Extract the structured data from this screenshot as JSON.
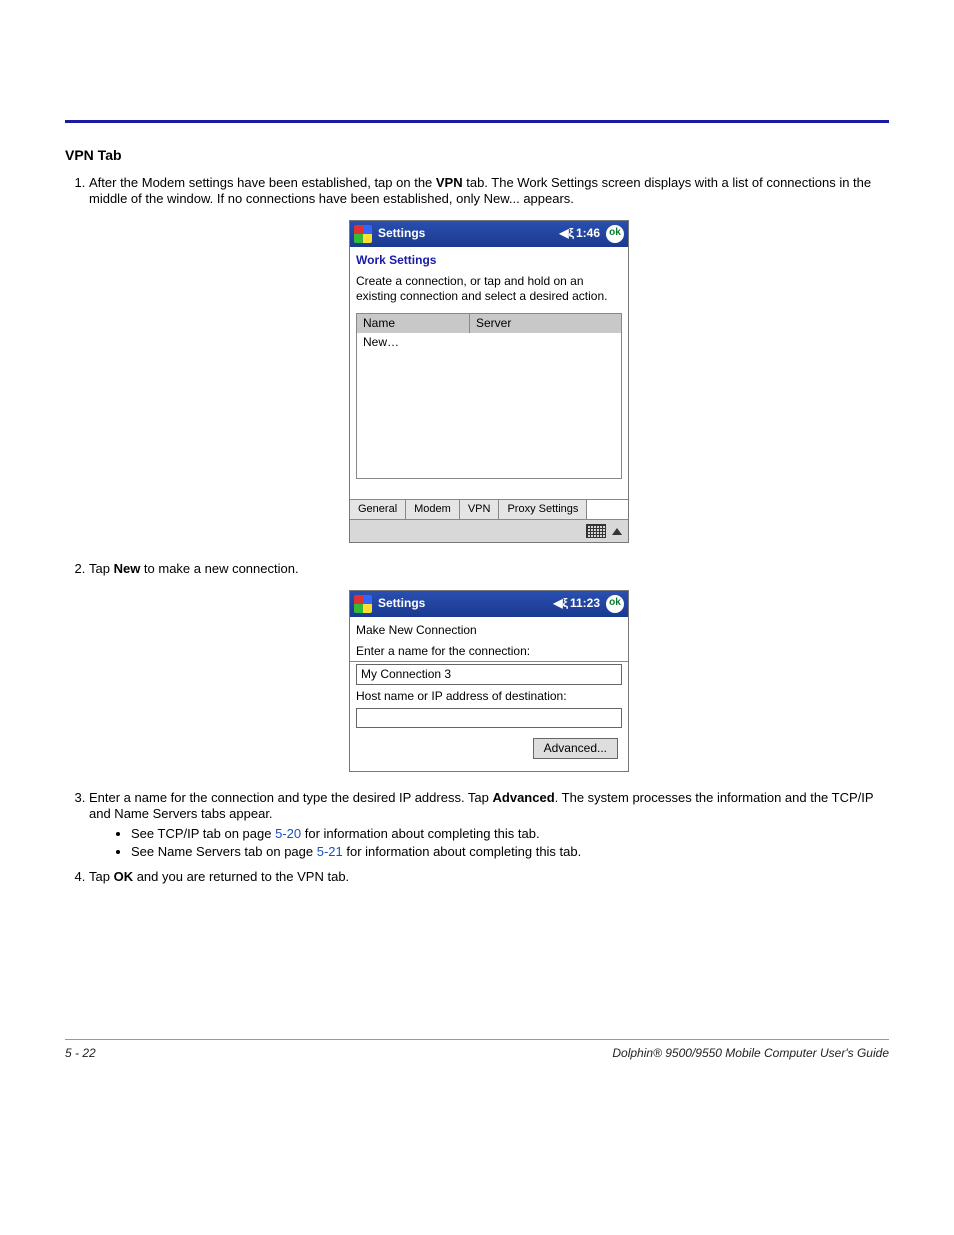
{
  "heading": "VPN Tab",
  "steps": {
    "s1a": "After the Modem settings have been established, tap on the ",
    "s1b": "VPN",
    "s1c": " tab. The Work Settings screen displays with a list of connections in the middle of the window. If no connections have been established, only New... appears.",
    "s2a": "Tap ",
    "s2b": "New",
    "s2c": " to make a new connection.",
    "s3a": "Enter a name for the connection and type the desired IP address. Tap ",
    "s3b": "Advanced",
    "s3c": ". The system processes the information and the TCP/IP and Name Servers tabs appear.",
    "bullet1a": "See TCP/IP tab on page ",
    "bullet1b": "5-20",
    "bullet1c": " for information about completing this tab.",
    "bullet2a": "See Name Servers tab on page ",
    "bullet2b": "5-21",
    "bullet2c": " for information about completing this tab.",
    "s4a": "Tap ",
    "s4b": "OK",
    "s4c": " and you are returned to the VPN tab."
  },
  "screen1": {
    "title": "Settings",
    "time": "1:46",
    "ok": "ok",
    "subhead": "Work Settings",
    "instruction": "Create a connection, or tap and hold on an existing connection and select a desired action.",
    "col_name": "Name",
    "col_server": "Server",
    "row_new": "New…",
    "tabs": {
      "general": "General",
      "modem": "Modem",
      "vpn": "VPN",
      "proxy": "Proxy Settings"
    }
  },
  "screen2": {
    "title": "Settings",
    "time": "11:23",
    "ok": "ok",
    "subhead": "Make New Connection",
    "label_name": "Enter a name for the connection:",
    "value_name": "My Connection 3",
    "label_host": "Host name or IP address of destination:",
    "value_host": "",
    "btn_advanced": "Advanced..."
  },
  "footer": {
    "page": "5 - 22",
    "doc": "Dolphin® 9500/9550 Mobile Computer User's Guide"
  }
}
